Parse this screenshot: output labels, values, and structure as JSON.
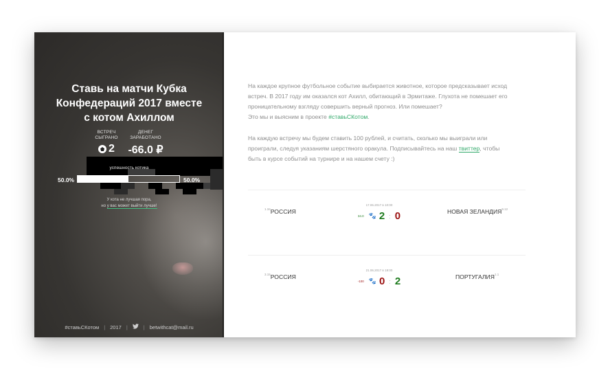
{
  "sidebar": {
    "title_lines": [
      "Ставь на матчи Кубка",
      "Конфедераций 2017 вместе",
      "с котом Ахиллом"
    ],
    "stats": {
      "games_label_1": "встреч",
      "games_label_2": "сыграно",
      "games_value": "2",
      "money_label_1": "денег",
      "money_label_2": "заработано",
      "money_value": "-66.0 ₽"
    },
    "success_label": "успешность котика",
    "success_left": "50.0%",
    "success_right": "50.0%",
    "success_fraction": 0.5,
    "note_line1": "У кота не лучшая пора,",
    "note_line2_prefix": "но ",
    "note_link": "у вас может выйти лучше!",
    "footer": {
      "hashtag": "#ставьСКотом",
      "year": "2017",
      "twitter_icon": "twitter-icon",
      "email": "betwithcat@mail.ru"
    }
  },
  "content": {
    "para1_line1": "На каждое крупное футбольное событие выбирается животное, которое предсказывает исход",
    "para1_line2": "встреч. В 2017 году им оказался кот Ахилл, обитающий в Эрмитаже. Глухота не помешает его",
    "para1_line3": "проницательному взгляду совершить верный прогноз. Или помешает?",
    "para1_line4_prefix": "Это мы и выясним в проекте ",
    "para1_hashtag": "#ставьСКотом",
    "para1_line4_suffix": ".",
    "para2_line1": "На каждую встречу мы будем ставить 100 рублей, и считать, сколько мы выиграли или",
    "para2_line2_prefix": "проиграли, следуя указаниям шерстяного оракула. Подписывайтесь на наш ",
    "para2_link": "твиттер",
    "para2_line2_suffix": ", чтобы",
    "para2_line3": "быть в курсе событий на турнире и на нашем счету :)"
  },
  "matches": [
    {
      "home_odds": "1.34",
      "home": "РОССИЯ",
      "date": "17.06.2017 в 10:00",
      "diff": "34.0",
      "home_score": "2",
      "away_score": "0",
      "away": "НОВАЯ ЗЕЛАНДИЯ",
      "away_odds": "9.12"
    },
    {
      "home_odds": "3.15",
      "home": "РОССИЯ",
      "date": "21.06.2017 в 18:00",
      "diff": "-100",
      "home_score": "0",
      "away_score": "2",
      "away": "ПОРТУГАЛИЯ",
      "away_odds": "1.1"
    }
  ],
  "colors": {
    "accent_green": "#2fa868",
    "score_green": "#1c7a1c",
    "score_red": "#9b1010"
  }
}
